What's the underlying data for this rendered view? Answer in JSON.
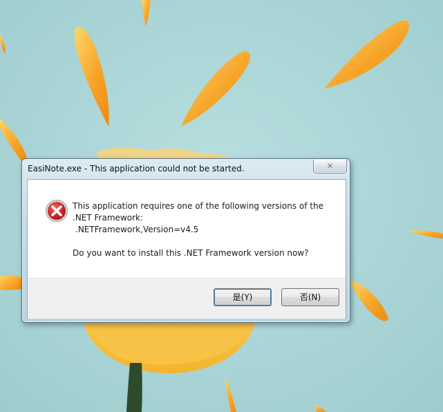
{
  "dialog": {
    "title": "EasiNote.exe - This application could not be started.",
    "close_glyph": "✕",
    "icon": "error-icon",
    "message": {
      "line1": "This application requires one of the following versions of the",
      "line2": ".NET Framework:",
      "line3": ".NETFramework,Version=v4.5",
      "line4": "Do you want to install this .NET Framework version now?"
    },
    "buttons": {
      "yes": "是(Y)",
      "no": "否(N)"
    }
  },
  "colors": {
    "background": "#a9d4d6",
    "petal": "#f6a21c",
    "flower": "#f9c63f",
    "error_red": "#c8202a"
  }
}
